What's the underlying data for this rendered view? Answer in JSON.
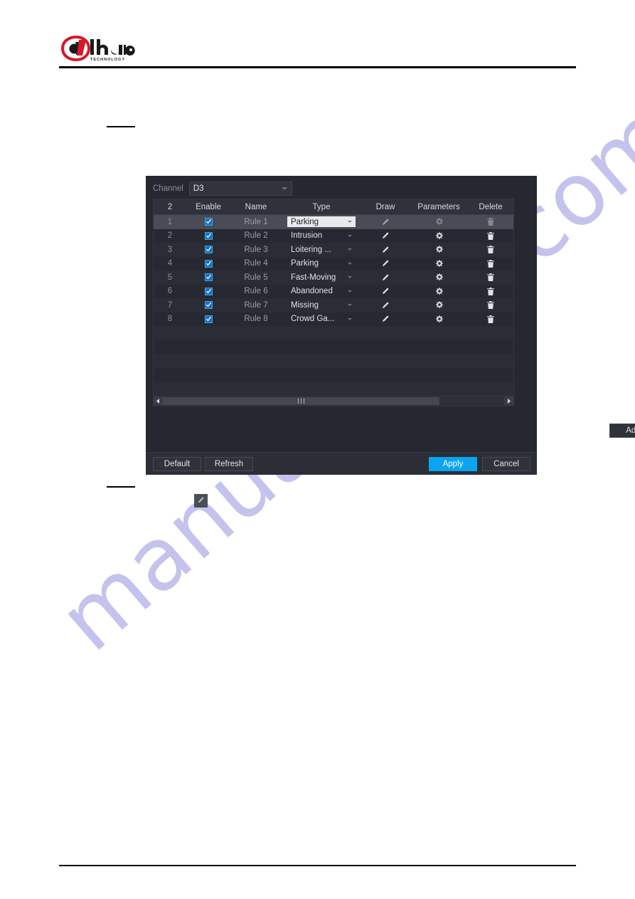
{
  "brand": {
    "logo_text": "alhua",
    "logo_sub": "TECHNOLOGY",
    "logo_color_red": "#D7182A",
    "logo_color_dark": "#1A1A1A"
  },
  "watermark": {
    "text": "manualshive.com",
    "color": "#2b2bbf"
  },
  "dialog": {
    "channel": {
      "label": "Channel",
      "value": "D3",
      "caret": "chevron-down-icon"
    },
    "table": {
      "headers": {
        "index": "2",
        "enable": "Enable",
        "name": "Name",
        "type": "Type",
        "draw": "Draw",
        "parameters": "Parameters",
        "delete": "Delete"
      },
      "rows": [
        {
          "index": "1",
          "enabled": true,
          "name": "Rule 1",
          "type": "Parking",
          "selected": true
        },
        {
          "index": "2",
          "enabled": true,
          "name": "Rule 2",
          "type": "Intrusion",
          "selected": false
        },
        {
          "index": "3",
          "enabled": true,
          "name": "Rule 3",
          "type": "Loitering ...",
          "selected": false
        },
        {
          "index": "4",
          "enabled": true,
          "name": "Rule 4",
          "type": "Parking",
          "selected": false
        },
        {
          "index": "5",
          "enabled": true,
          "name": "Rule 5",
          "type": "Fast-Moving",
          "selected": false
        },
        {
          "index": "6",
          "enabled": true,
          "name": "Rule 6",
          "type": "Abandoned",
          "selected": false
        },
        {
          "index": "7",
          "enabled": true,
          "name": "Rule 7",
          "type": "Missing",
          "selected": false
        },
        {
          "index": "8",
          "enabled": true,
          "name": "Rule 8",
          "type": "Crowd Ga...",
          "selected": false
        }
      ],
      "empty_row_count": 5,
      "scrollbar": {
        "left_arrow": "arrow-left-icon",
        "right_arrow": "arrow-right-icon",
        "thumb_percent": 81
      },
      "icons": {
        "draw": "pencil-icon",
        "parameters": "gear-icon",
        "delete": "trash-icon",
        "enable": "checkmark-icon"
      }
    },
    "add_label": "Add",
    "footer": {
      "default_label": "Default",
      "refresh_label": "Refresh",
      "apply_label": "Apply",
      "cancel_label": "Cancel",
      "apply_color": "#0aa4f0"
    }
  },
  "edit_chip": {
    "icon": "pencil-icon"
  }
}
